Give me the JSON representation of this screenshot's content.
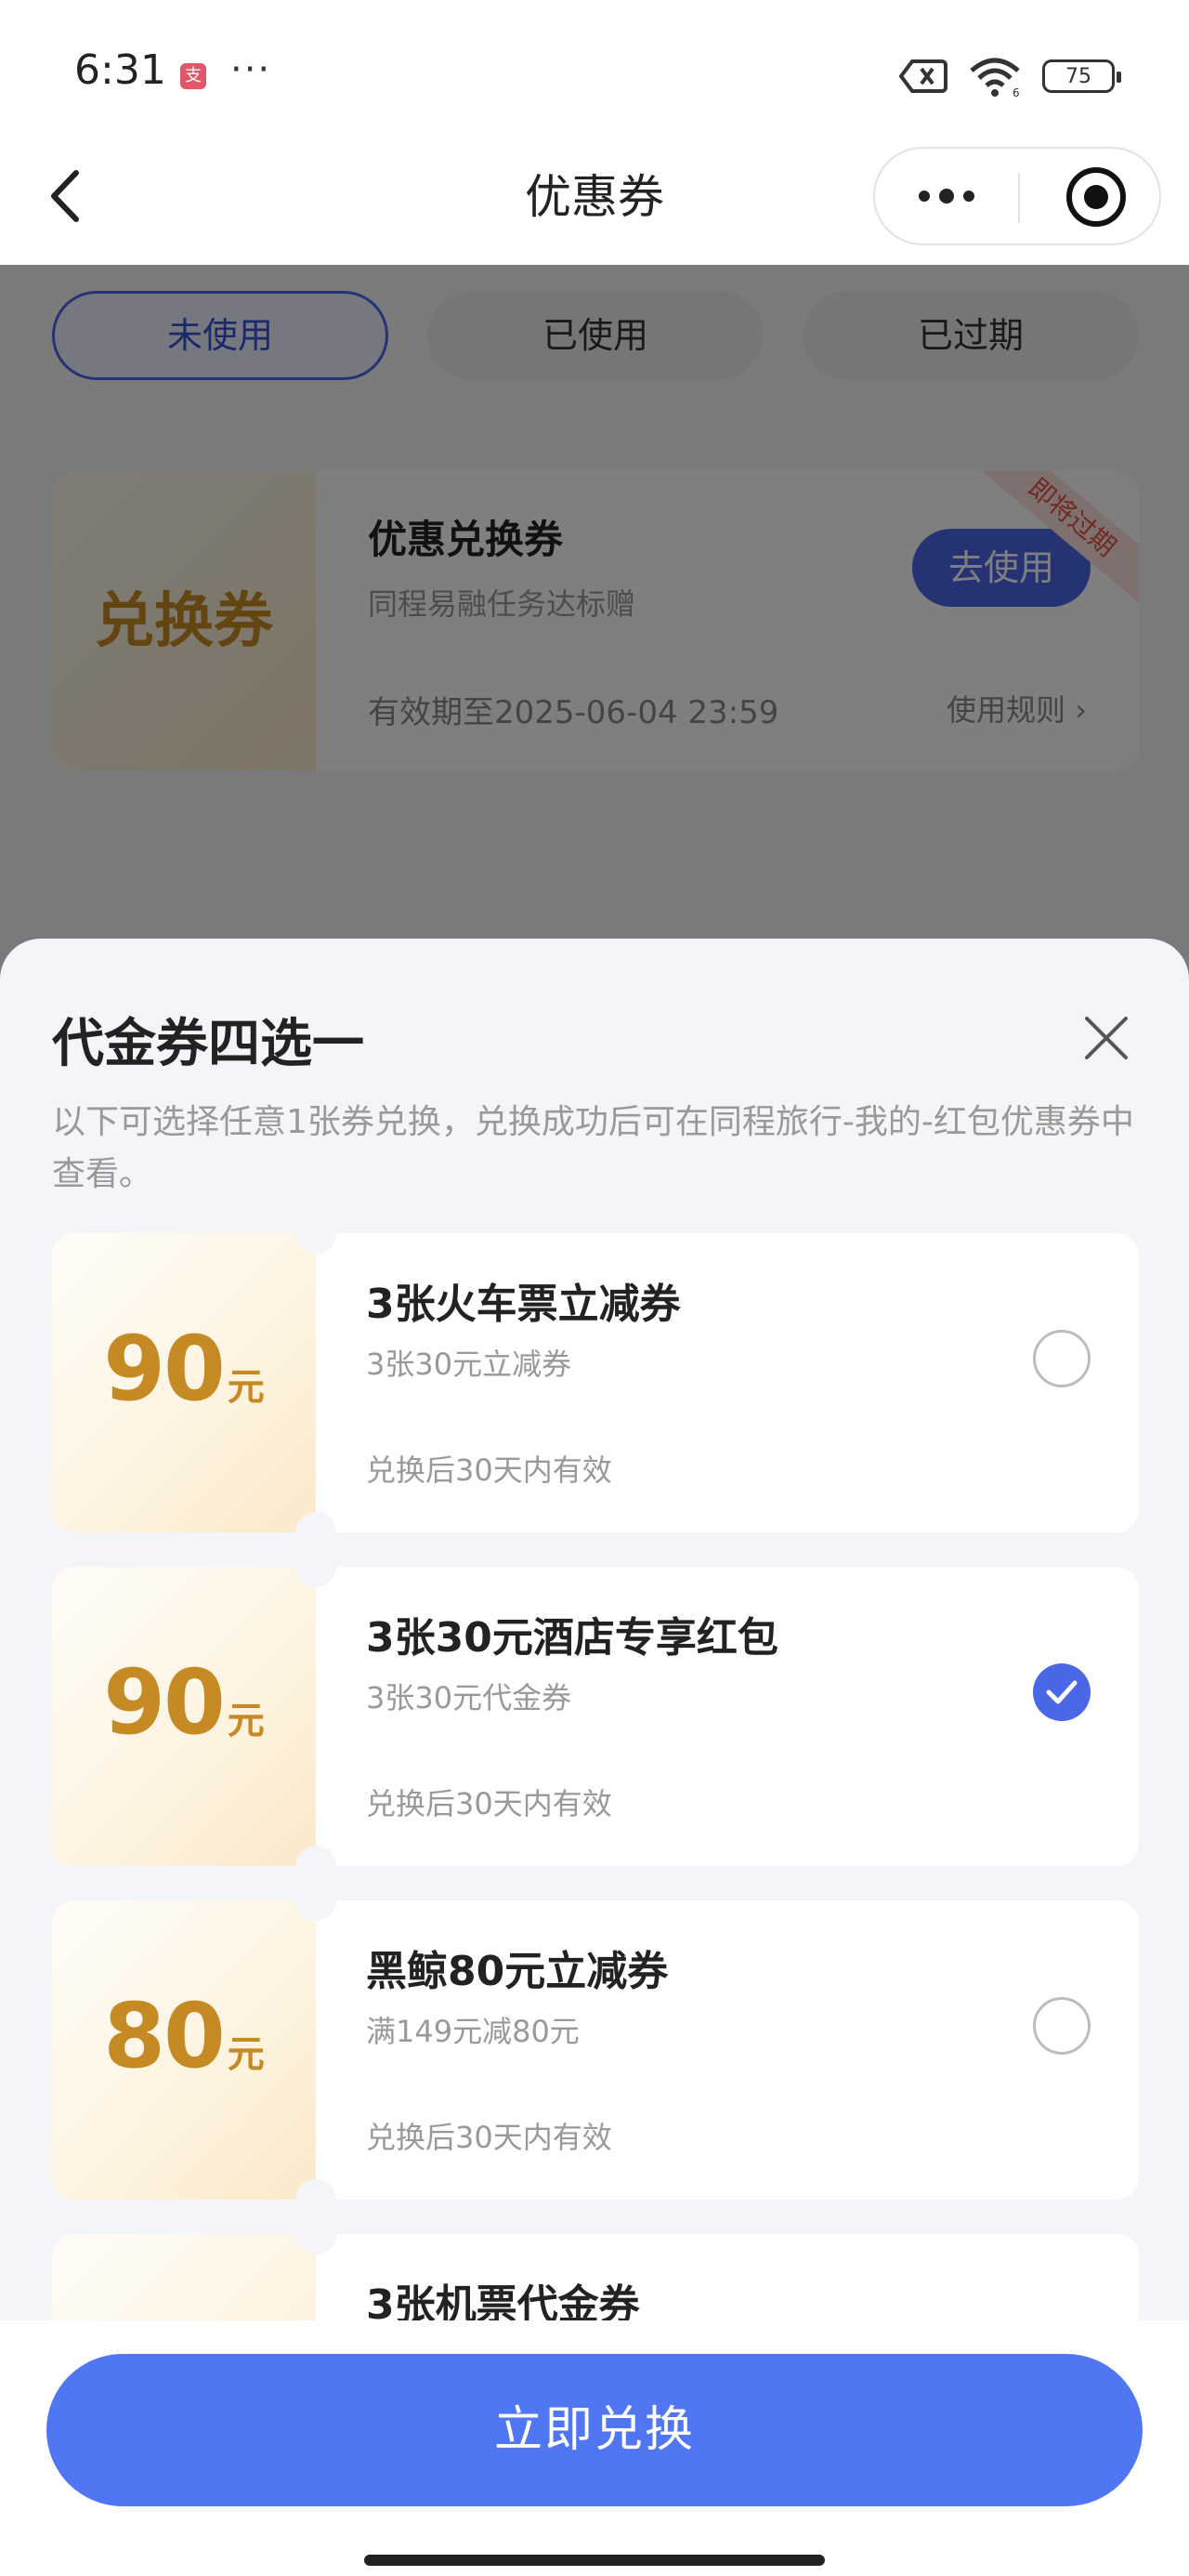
{
  "status_bar": {
    "time": "6:31",
    "app_icon": "支",
    "more": "···",
    "battery": "75",
    "icons": [
      "sim-error-icon",
      "wifi-icon",
      "battery-icon"
    ]
  },
  "nav": {
    "title": "优惠券",
    "back_icon": "chevron-left-icon",
    "more_icon": "more-dots-icon",
    "close_icon": "target-close-icon"
  },
  "tabs": [
    {
      "label": "未使用",
      "active": true
    },
    {
      "label": "已使用",
      "active": false
    },
    {
      "label": "已过期",
      "active": false
    }
  ],
  "background_coupon": {
    "stub_label": "兑换券",
    "title": "优惠兑换券",
    "subtitle": "同程易融任务达标赠",
    "validity": "有效期至2025-06-04 23:59",
    "rules": "使用规则",
    "use_button": "去使用",
    "ribbon": "即将过期"
  },
  "sheet": {
    "title": "代金券四选一",
    "description": "以下可选择任意1张券兑换，兑换成功后可在同程旅行-我的-红包优惠券中查看。",
    "vouchers": [
      {
        "amount": "90",
        "unit": "元",
        "title": "3张火车票立减券",
        "subtitle": "3张30元立减券",
        "validity": "兑换后30天内有效",
        "selected": false
      },
      {
        "amount": "90",
        "unit": "元",
        "title": "3张30元酒店专享红包",
        "subtitle": "3张30元代金券",
        "validity": "兑换后30天内有效",
        "selected": true
      },
      {
        "amount": "80",
        "unit": "元",
        "title": "黑鲸80元立减券",
        "subtitle": "满149元减80元",
        "validity": "兑换后30天内有效",
        "selected": false
      },
      {
        "amount": "",
        "unit": "",
        "title": "3张机票代金券",
        "subtitle": "",
        "validity": "",
        "selected": false
      }
    ],
    "confirm_button": "立即兑换"
  },
  "colors": {
    "accent": "#4a67e8",
    "button": "#5076f3",
    "amount": "#c68a25",
    "ribbon_text": "#e05545"
  }
}
